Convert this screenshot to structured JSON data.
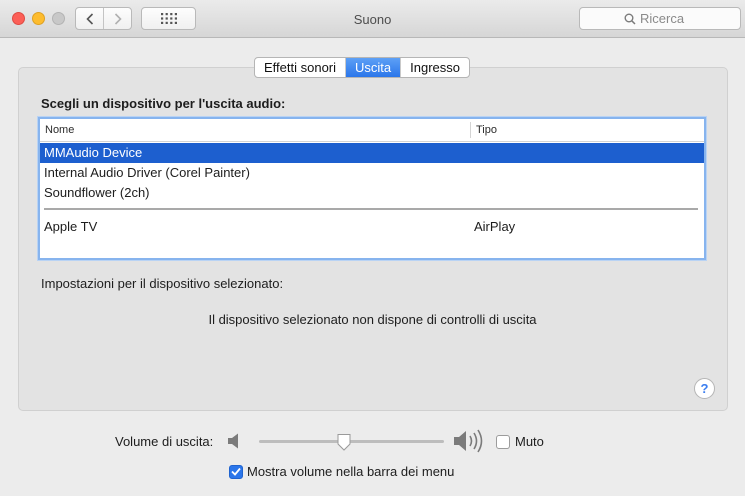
{
  "window": {
    "title": "Suono"
  },
  "search": {
    "placeholder": "Ricerca"
  },
  "tabs": [
    {
      "label": "Effetti sonori",
      "active": false
    },
    {
      "label": "Uscita",
      "active": true
    },
    {
      "label": "Ingresso",
      "active": false
    }
  ],
  "output": {
    "heading": "Scegli un dispositivo per l'uscita audio:",
    "columns": {
      "name": "Nome",
      "type": "Tipo"
    },
    "devices": [
      {
        "name": "MMAudio Device",
        "type": "",
        "selected": true
      },
      {
        "name": "Internal Audio Driver (Corel Painter)",
        "type": "",
        "selected": false
      },
      {
        "name": "Soundflower (2ch)",
        "type": "",
        "selected": false
      },
      {
        "name": "Apple TV",
        "type": "AirPlay",
        "selected": false
      }
    ],
    "settings_label": "Impostazioni per il dispositivo selezionato:",
    "no_controls": "Il dispositivo selezionato non dispone di controlli di uscita",
    "help": "?"
  },
  "volume": {
    "label": "Volume di uscita:",
    "level": 0.46,
    "mute_label": "Muto",
    "mute_checked": false,
    "show_in_menubar_label": "Mostra volume nella barra dei menu",
    "show_in_menubar_checked": true
  },
  "colors": {
    "accent": "#2b76ea",
    "selection": "#1d5fcf"
  }
}
